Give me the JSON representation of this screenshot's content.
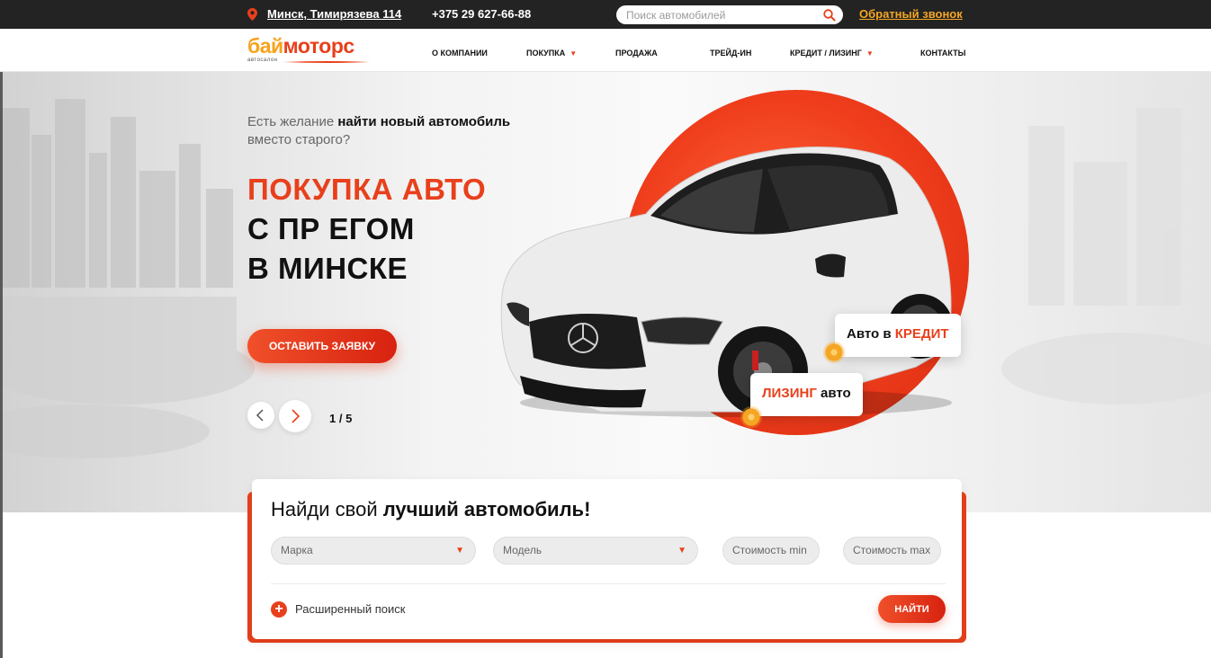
{
  "topbar": {
    "address": "Минск, Тимирязева 114",
    "phone": "+375 29 627-66-88",
    "search_placeholder": "Поиск автомобилей",
    "callback": "Обратный звонок",
    "icons": [
      "map-pin-icon",
      "search-icon"
    ]
  },
  "logo": {
    "part1": "бай",
    "part2": "моторс",
    "sub": "автосалон"
  },
  "nav": [
    {
      "label": "О КОМПАНИИ",
      "dropdown": false
    },
    {
      "label": "ПОКУПКА",
      "dropdown": true
    },
    {
      "label": "ПРОДАЖА",
      "dropdown": false
    },
    {
      "label": "ТРЕЙД-ИН",
      "dropdown": false
    },
    {
      "label": "КРЕДИТ / ЛИЗИНГ",
      "dropdown": true
    },
    {
      "label": "КОНТАКТЫ",
      "dropdown": false
    }
  ],
  "hero": {
    "lead_prefix": "Есть желание ",
    "lead_bold": "найти новый автомобиль",
    "lead_line2": "вместо старого?",
    "headline_red": "ПОКУПКА АВТО",
    "headline_line2": "С ПР ЕГОМ",
    "headline_line3": "В МИНСКЕ",
    "cta": "ОСТАВИТЬ ЗАЯВКУ",
    "slide_counter": "1 / 5",
    "badge_credit_prefix": "Авто в ",
    "badge_credit_accent": "КРЕДИТ",
    "badge_leasing_accent": "ЛИЗИНГ",
    "badge_leasing_suffix": " авто"
  },
  "search_panel": {
    "title_prefix": "Найди свой ",
    "title_bold": "лучший автомобиль!",
    "brand": "Марка",
    "model": "Модель",
    "price_min": "Стоимость min",
    "price_max": "Стоимость max",
    "advanced": "Расширенный поиск",
    "find": "НАЙТИ"
  },
  "colors": {
    "accent": "#e8401c",
    "accent_yellow": "#f5a623",
    "topbar_bg": "#232323"
  }
}
